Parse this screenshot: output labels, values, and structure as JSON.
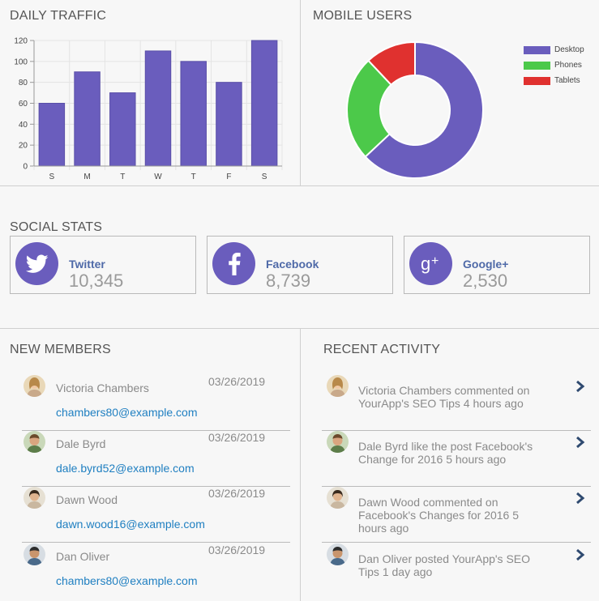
{
  "traffic": {
    "title": "DAILY TRAFFIC",
    "chart_data": {
      "type": "bar",
      "categories": [
        "S",
        "M",
        "T",
        "W",
        "T",
        "F",
        "S"
      ],
      "values": [
        60,
        90,
        70,
        110,
        100,
        80,
        120
      ],
      "yticks": [
        0,
        20,
        40,
        60,
        80,
        100,
        120
      ],
      "ylim": [
        0,
        120
      ],
      "title": "",
      "xlabel": "",
      "ylabel": "",
      "grid": true,
      "color": "#6a5dbd"
    }
  },
  "mobile": {
    "title": "MOBILE USERS",
    "chart_data": {
      "type": "pie",
      "donut": true,
      "labels": [
        "Desktop",
        "Phones",
        "Tablets"
      ],
      "values": [
        63,
        25,
        12
      ],
      "colors": [
        "#6a5dbd",
        "#4cc94a",
        "#e0312f"
      ],
      "legend": "top-right"
    }
  },
  "social": {
    "title": "SOCIAL STATS",
    "cards": [
      {
        "name": "Twitter",
        "count": "10,345",
        "icon": "twitter-icon"
      },
      {
        "name": "Facebook",
        "count": "8,739",
        "icon": "facebook-icon"
      },
      {
        "name": "Google+",
        "count": "2,530",
        "icon": "google-plus-icon"
      }
    ]
  },
  "members": {
    "title": "NEW MEMBERS",
    "items": [
      {
        "name": "Victoria Chambers",
        "date": "03/26/2019",
        "email": "chambers80@example.com"
      },
      {
        "name": "Dale Byrd",
        "date": "03/26/2019",
        "email": "dale.byrd52@example.com"
      },
      {
        "name": "Dawn Wood",
        "date": "03/26/2019",
        "email": "dawn.wood16@example.com"
      },
      {
        "name": "Dan Oliver",
        "date": "03/26/2019",
        "email": "chambers80@example.com"
      }
    ]
  },
  "activity": {
    "title": "RECENT ACTIVITY",
    "items": [
      {
        "text": "Victoria Chambers commented on YourApp's SEO Tips 4 hours ago"
      },
      {
        "text": "Dale Byrd like the post Facebook's Change for 2016 5 hours ago"
      },
      {
        "text": "Dawn Wood commented on Facebook's Changes for 2016 5 hours ago"
      },
      {
        "text": "Dan Oliver posted YourApp's SEO Tips 1 day ago"
      }
    ]
  },
  "colors": {
    "accent": "#6a5dbd",
    "link": "#1f7fc1",
    "phones": "#4cc94a",
    "tablets": "#e0312f"
  }
}
